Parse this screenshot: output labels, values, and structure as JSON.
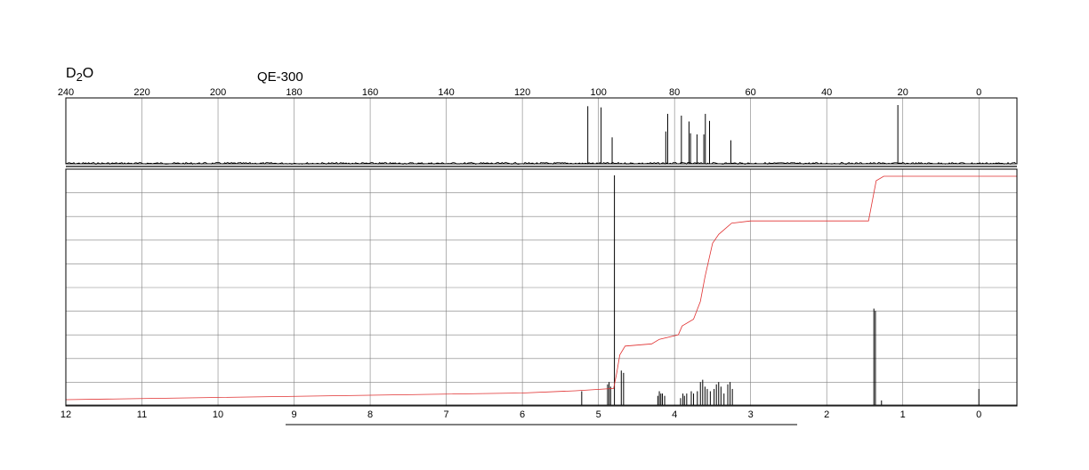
{
  "header": {
    "solvent_main": "D",
    "solvent_sub": "2",
    "solvent_tail": "O",
    "instrument": "QE-300"
  },
  "colors": {
    "frame": "#000000",
    "grid": "#808080",
    "spectrum": "#000000",
    "integral": "#e03030"
  },
  "chart_data": [
    {
      "type": "line",
      "name": "13C NMR",
      "x_axis": {
        "range": [
          240,
          -10
        ],
        "reversed": true,
        "ticks": [
          240,
          220,
          200,
          180,
          160,
          140,
          120,
          100,
          80,
          60,
          40,
          20,
          0
        ],
        "position": "top"
      },
      "peaks_ppm": [
        {
          "x": 102.8,
          "h": 0.98
        },
        {
          "x": 99.3,
          "h": 0.96
        },
        {
          "x": 96.4,
          "h": 0.45
        },
        {
          "x": 82.3,
          "h": 0.55
        },
        {
          "x": 81.8,
          "h": 0.85
        },
        {
          "x": 78.2,
          "h": 0.82
        },
        {
          "x": 76.2,
          "h": 0.72
        },
        {
          "x": 75.8,
          "h": 0.52
        },
        {
          "x": 74.1,
          "h": 0.5
        },
        {
          "x": 72.3,
          "h": 0.5
        },
        {
          "x": 71.9,
          "h": 0.85
        },
        {
          "x": 70.8,
          "h": 0.73
        },
        {
          "x": 65.2,
          "h": 0.4
        },
        {
          "x": 21.3,
          "h": 1.0
        }
      ]
    },
    {
      "type": "line",
      "name": "1H NMR",
      "x_axis": {
        "range": [
          12,
          -0.5
        ],
        "reversed": true,
        "ticks": [
          12,
          11,
          10,
          9,
          8,
          7,
          6,
          5,
          4,
          3,
          2,
          1,
          0
        ],
        "position": "bottom"
      },
      "grid": true,
      "peaks_ppm": [
        {
          "x": 5.22,
          "h": 0.06
        },
        {
          "x": 4.88,
          "h": 0.09
        },
        {
          "x": 4.86,
          "h": 0.1
        },
        {
          "x": 4.84,
          "h": 0.08
        },
        {
          "x": 4.79,
          "h": 1.0
        },
        {
          "x": 4.7,
          "h": 0.15
        },
        {
          "x": 4.67,
          "h": 0.14
        },
        {
          "x": 4.22,
          "h": 0.04
        },
        {
          "x": 4.2,
          "h": 0.06
        },
        {
          "x": 4.18,
          "h": 0.05
        },
        {
          "x": 4.16,
          "h": 0.05
        },
        {
          "x": 4.13,
          "h": 0.04
        },
        {
          "x": 3.92,
          "h": 0.03
        },
        {
          "x": 3.89,
          "h": 0.05
        },
        {
          "x": 3.87,
          "h": 0.04
        },
        {
          "x": 3.84,
          "h": 0.05
        },
        {
          "x": 3.78,
          "h": 0.06
        },
        {
          "x": 3.75,
          "h": 0.05
        },
        {
          "x": 3.7,
          "h": 0.06
        },
        {
          "x": 3.66,
          "h": 0.1
        },
        {
          "x": 3.63,
          "h": 0.11
        },
        {
          "x": 3.6,
          "h": 0.08
        },
        {
          "x": 3.57,
          "h": 0.07
        },
        {
          "x": 3.53,
          "h": 0.06
        },
        {
          "x": 3.48,
          "h": 0.07
        },
        {
          "x": 3.45,
          "h": 0.09
        },
        {
          "x": 3.42,
          "h": 0.1
        },
        {
          "x": 3.39,
          "h": 0.08
        },
        {
          "x": 3.35,
          "h": 0.05
        },
        {
          "x": 3.3,
          "h": 0.09
        },
        {
          "x": 3.27,
          "h": 0.1
        },
        {
          "x": 3.24,
          "h": 0.07
        },
        {
          "x": 1.38,
          "h": 0.42
        },
        {
          "x": 1.36,
          "h": 0.41
        },
        {
          "x": 1.28,
          "h": 0.02
        },
        {
          "x": 0.0,
          "h": 0.07
        }
      ],
      "integral_ppm": [
        [
          12,
          0.0
        ],
        [
          10,
          0.01
        ],
        [
          8,
          0.02
        ],
        [
          6,
          0.03
        ],
        [
          5.3,
          0.04
        ],
        [
          4.8,
          0.05
        ],
        [
          4.76,
          0.12
        ],
        [
          4.72,
          0.2
        ],
        [
          4.65,
          0.24
        ],
        [
          4.3,
          0.25
        ],
        [
          4.2,
          0.27
        ],
        [
          3.95,
          0.29
        ],
        [
          3.9,
          0.33
        ],
        [
          3.75,
          0.36
        ],
        [
          3.66,
          0.44
        ],
        [
          3.6,
          0.55
        ],
        [
          3.5,
          0.7
        ],
        [
          3.42,
          0.74
        ],
        [
          3.25,
          0.79
        ],
        [
          3.0,
          0.8
        ],
        [
          1.45,
          0.8
        ],
        [
          1.35,
          0.98
        ],
        [
          1.25,
          1.0
        ],
        [
          0.0,
          1.0
        ],
        [
          -0.5,
          1.0
        ]
      ]
    }
  ]
}
